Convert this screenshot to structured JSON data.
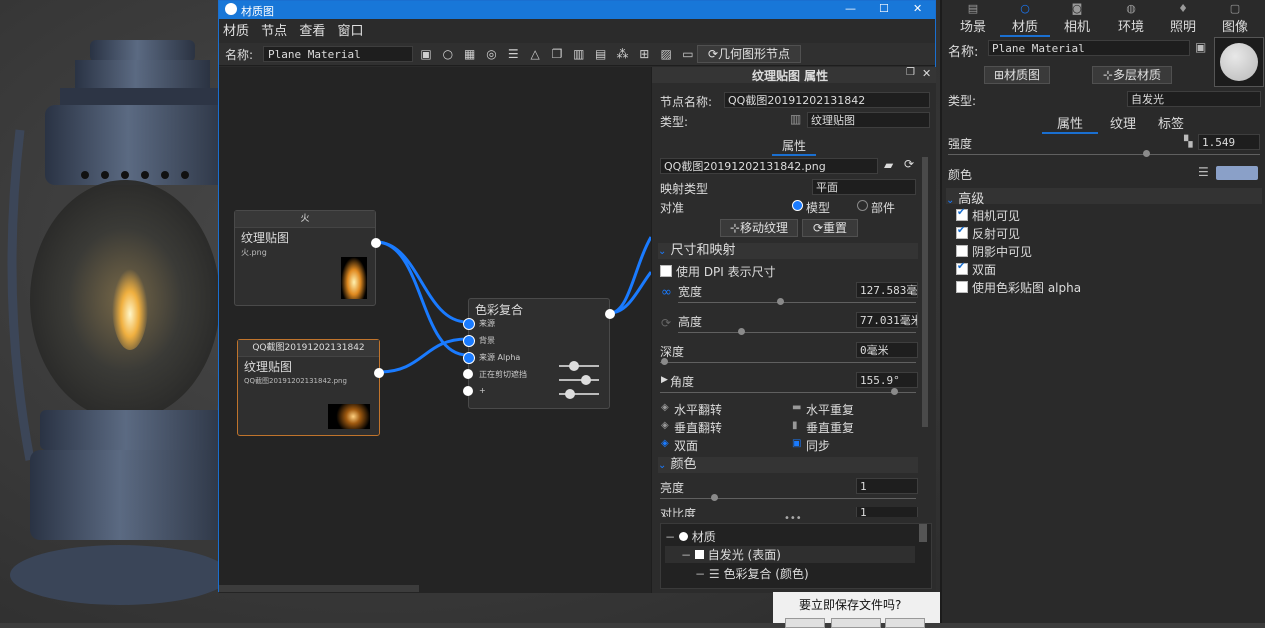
{
  "window": {
    "title": "材质图",
    "minimize": "—",
    "maximize": "☐",
    "close": "✕"
  },
  "menu": [
    "材质",
    "节点",
    "查看",
    "窗口"
  ],
  "toolbar": {
    "name_label": "名称:",
    "name_value": "Plane Material",
    "geometry_node_label": "几何图形节点"
  },
  "nodes": {
    "fire": {
      "header": "火",
      "title": "纹理贴图",
      "file": "火.png"
    },
    "qq": {
      "header": "QQ截图20191202131842",
      "title": "纹理贴图",
      "file": "QQ截图20191202131842.png"
    },
    "mix": {
      "title": "色彩复合",
      "inputs": [
        "来源",
        "背景",
        "来源 Alpha",
        "正在剪切遮挡",
        "+"
      ]
    }
  },
  "props": {
    "header": "纹理贴图 属性",
    "node_name_label": "节点名称:",
    "node_name_value": "QQ截图20191202131842",
    "type_label": "类型:",
    "type_value": "纹理贴图",
    "tab": "属性",
    "file_value": "QQ截图20191202131842.png",
    "map_type_label": "映射类型",
    "map_type_value": "平面",
    "align_label": "对准",
    "align_model": "模型",
    "align_part": "部件",
    "move_texture": "移动纹理",
    "reset": "重置",
    "size_section": "尺寸和映射",
    "dpi_label": "使用 DPI 表示尺寸",
    "width_label": "宽度",
    "width_value": "127.583毫米",
    "height_label": "高度",
    "height_value": "77.031毫米",
    "depth_label": "深度",
    "depth_value": "0毫米",
    "angle_label": "角度",
    "angle_value": "155.9°",
    "flip_h": "水平翻转",
    "repeat_h": "水平重复",
    "flip_v": "垂直翻转",
    "repeat_v": "垂直重复",
    "two_sided": "双面",
    "sync": "同步",
    "color_section": "颜色",
    "brightness_label": "亮度",
    "brightness_value": "1",
    "contrast_label": "对比度",
    "contrast_value": "1",
    "more": "•••",
    "tree": [
      "材质",
      "自发光 (表面)",
      "色彩复合 (颜色)"
    ]
  },
  "dialog": {
    "text": "要立即保存文件吗?"
  },
  "right": {
    "tabs": [
      {
        "label": "场景",
        "icon": "▤"
      },
      {
        "label": "材质",
        "icon": "○"
      },
      {
        "label": "相机",
        "icon": "◙"
      },
      {
        "label": "环境",
        "icon": "◍"
      },
      {
        "label": "照明",
        "icon": "♦"
      },
      {
        "label": "图像",
        "icon": "▢"
      }
    ],
    "name_label": "名称:",
    "name_value": "Plane Material",
    "material_graph_btn": "材质图",
    "multi_layer_btn": "多层材质",
    "type_label": "类型:",
    "type_value": "自发光",
    "subtabs": [
      "属性",
      "纹理",
      "标签"
    ],
    "intensity_label": "强度",
    "intensity_value": "1.549",
    "color_label": "颜色",
    "advanced_label": "高级",
    "checks": [
      {
        "label": "相机可见",
        "on": true
      },
      {
        "label": "反射可见",
        "on": true
      },
      {
        "label": "阴影中可见",
        "on": false
      },
      {
        "label": "双面",
        "on": true
      },
      {
        "label": "使用色彩贴图 alpha",
        "on": false
      }
    ],
    "accent": "#8aa0c8"
  }
}
